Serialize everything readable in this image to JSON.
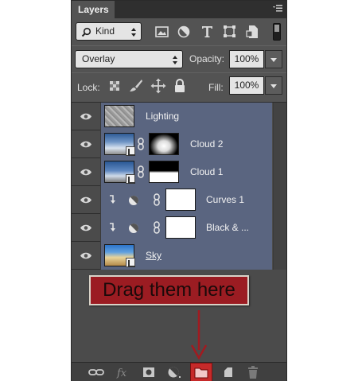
{
  "panel": {
    "tab_title": "Layers"
  },
  "filter": {
    "kind_label": "Kind",
    "icons": [
      "pixel-filter-icon",
      "adjustment-filter-icon",
      "type-filter-icon",
      "shape-filter-icon",
      "smart-object-filter-icon"
    ]
  },
  "blend": {
    "mode": "Overlay",
    "opacity_label": "Opacity:",
    "opacity_value": "100%"
  },
  "lock": {
    "label": "Lock:",
    "fill_label": "Fill:",
    "fill_value": "100%"
  },
  "layers": [
    {
      "name": "Lighting",
      "type": "pixel"
    },
    {
      "name": "Cloud 2",
      "type": "smart-object-masked"
    },
    {
      "name": "Cloud 1",
      "type": "smart-object-masked"
    },
    {
      "name": "Curves 1",
      "type": "adjustment-clipped"
    },
    {
      "name": "Black & ...",
      "type": "adjustment-clipped"
    },
    {
      "name": "Sky",
      "type": "smart-object"
    }
  ],
  "callout": {
    "text": "Drag them here",
    "color": "#9b1c22"
  },
  "bottom_bar": {
    "icons": [
      "link-layers-icon",
      "fx-icon",
      "add-mask-icon",
      "new-fill-adjustment-icon",
      "new-group-icon",
      "new-layer-icon",
      "trash-icon"
    ],
    "highlight_color": "#c62a2a"
  }
}
